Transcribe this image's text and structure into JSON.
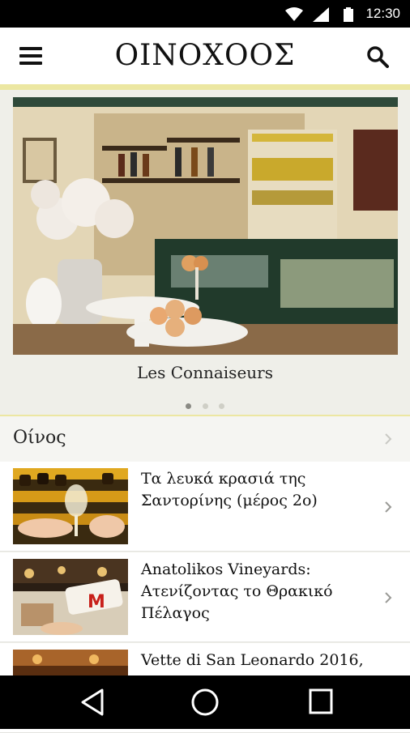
{
  "status_bar": {
    "time": "12:30"
  },
  "app_bar": {
    "title": "ΟΙΝΟΧΟΟΣ"
  },
  "featured": {
    "caption": "Les Connaiseurs",
    "total_slides": 3,
    "active_slide": 1
  },
  "section": {
    "title": "Οίνος"
  },
  "articles": [
    {
      "title": "Τα λευκά κρασιά της Σαντορίνης (μέρος 2ο)"
    },
    {
      "title": "Anatolikos Vineyards: Ατενίζοντας το Θρακικό Πέλαγος"
    },
    {
      "title": "Vette di San Leonardo 2016,"
    }
  ],
  "colors": {
    "accent": "#ece7a2",
    "background": "#efefe9"
  },
  "icons": [
    "wifi-icon",
    "signal-icon",
    "battery-icon",
    "menu-icon",
    "search-icon",
    "chevron-right-icon",
    "back-icon",
    "home-icon",
    "recents-icon"
  ]
}
